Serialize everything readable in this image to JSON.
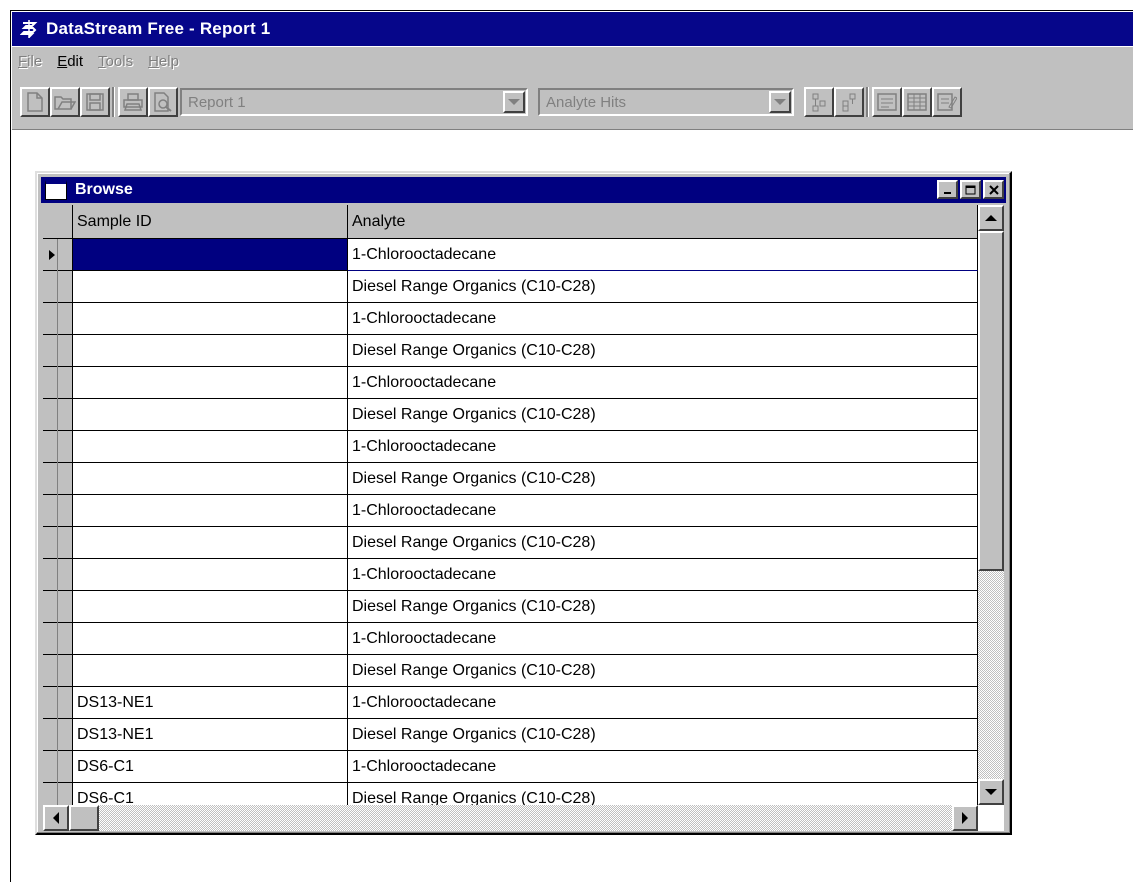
{
  "window": {
    "title": "DataStream Free - Report 1",
    "icon": "dollar-sign-icon"
  },
  "menu": [
    {
      "label": "File",
      "underline": "F",
      "rest": "ile",
      "enabled": false
    },
    {
      "label": "Edit",
      "underline": "E",
      "rest": "dit",
      "enabled": true
    },
    {
      "label": "Tools",
      "underline": "T",
      "rest": "ools",
      "enabled": false
    },
    {
      "label": "Help",
      "underline": "H",
      "rest": "elp",
      "enabled": false
    }
  ],
  "toolbar": {
    "buttons": [
      "new-document-icon",
      "open-folder-icon",
      "save-disk-icon",
      "print-icon",
      "print-preview-icon",
      "move-down-icon",
      "move-up-icon",
      "form-view-icon",
      "grid-view-icon",
      "edit-report-icon"
    ],
    "report_select": "Report 1",
    "query_select": "Analyte Hits"
  },
  "browse": {
    "title": "Browse",
    "columns": [
      "Sample ID",
      "Analyte"
    ],
    "rows": [
      {
        "sample": "",
        "analyte": "1-Chlorooctadecane"
      },
      {
        "sample": "",
        "analyte": "Diesel Range Organics (C10-C28)"
      },
      {
        "sample": "",
        "analyte": "1-Chlorooctadecane"
      },
      {
        "sample": "",
        "analyte": "Diesel Range Organics (C10-C28)"
      },
      {
        "sample": "",
        "analyte": "1-Chlorooctadecane"
      },
      {
        "sample": "",
        "analyte": "Diesel Range Organics (C10-C28)"
      },
      {
        "sample": "",
        "analyte": "1-Chlorooctadecane"
      },
      {
        "sample": "",
        "analyte": "Diesel Range Organics (C10-C28)"
      },
      {
        "sample": "",
        "analyte": "1-Chlorooctadecane"
      },
      {
        "sample": "",
        "analyte": "Diesel Range Organics (C10-C28)"
      },
      {
        "sample": "",
        "analyte": "1-Chlorooctadecane"
      },
      {
        "sample": "",
        "analyte": "Diesel Range Organics (C10-C28)"
      },
      {
        "sample": "",
        "analyte": "1-Chlorooctadecane"
      },
      {
        "sample": "",
        "analyte": "Diesel Range Organics (C10-C28)"
      },
      {
        "sample": "DS13-NE1",
        "analyte": "1-Chlorooctadecane"
      },
      {
        "sample": "DS13-NE1",
        "analyte": "Diesel Range Organics (C10-C28)"
      },
      {
        "sample": "DS6-C1",
        "analyte": "1-Chlorooctadecane"
      },
      {
        "sample": "DS6-C1",
        "analyte": "Diesel Range Organics (C10-C28)"
      }
    ],
    "active_row": 0
  },
  "colors": {
    "titlebar": "#000080",
    "face": "#c0c0c0",
    "selection": "#000080"
  }
}
